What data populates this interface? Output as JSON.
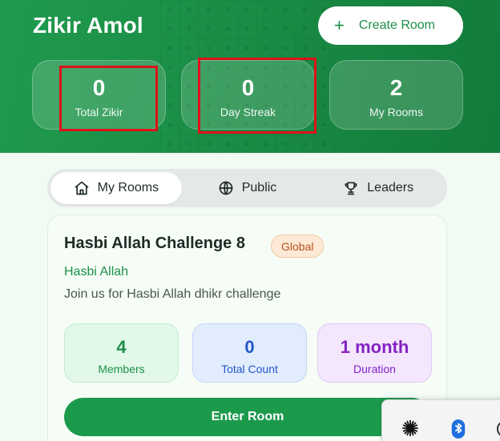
{
  "header": {
    "title": "Zikir Amol",
    "create_button": {
      "icon": "plus-icon",
      "label": "Create Room"
    }
  },
  "stats": [
    {
      "value": "0",
      "label": "Total Zikir"
    },
    {
      "value": "0",
      "label": "Day Streak"
    },
    {
      "value": "2",
      "label": "My Rooms"
    }
  ],
  "tabs": [
    {
      "icon": "home-icon",
      "label": "My Rooms",
      "active": true
    },
    {
      "icon": "globe-icon",
      "label": "Public",
      "active": false
    },
    {
      "icon": "trophy-icon",
      "label": "Leaders",
      "active": false
    }
  ],
  "room_card": {
    "title": "Hasbi Allah Challenge 8",
    "badge": "Global",
    "dhikr": "Hasbi Allah",
    "description": "Join us for Hasbi Allah dhikr challenge",
    "stats": [
      {
        "value": "4",
        "label": "Members"
      },
      {
        "value": "0",
        "label": "Total Count"
      },
      {
        "value": "1 month",
        "label": "Duration"
      }
    ],
    "enter_button": "Enter Room"
  },
  "tray": {
    "icons": [
      "starburst-icon",
      "bluetooth-icon",
      "partial-icon"
    ]
  },
  "colors": {
    "brand_green": "#1c9a4c",
    "highlight_red": "#e0101a"
  }
}
